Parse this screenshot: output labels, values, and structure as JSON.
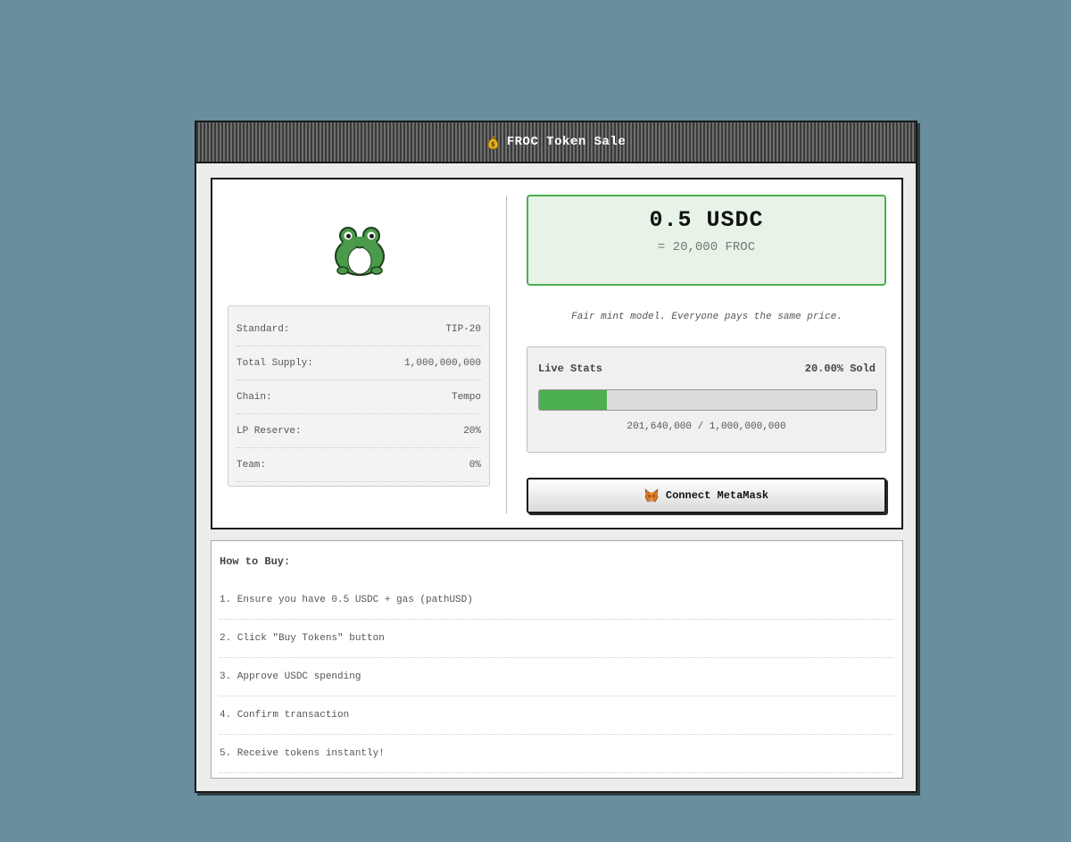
{
  "window": {
    "title": "FROC Token Sale"
  },
  "token_info": [
    {
      "label": "Standard:",
      "value": "TIP-20"
    },
    {
      "label": "Total Supply:",
      "value": "1,000,000,000"
    },
    {
      "label": "Chain:",
      "value": "Tempo"
    },
    {
      "label": "LP Reserve:",
      "value": "20%"
    },
    {
      "label": "Team:",
      "value": "0%"
    }
  ],
  "price": {
    "amount": "0.5 USDC",
    "equivalent": "= 20,000 FROC"
  },
  "fair_mint_note": "Fair mint model. Everyone pays the same price.",
  "live_stats": {
    "label": "Live Stats",
    "sold_text": "20.00% Sold",
    "progress_fraction": 0.2,
    "caption": "201,640,000 / 1,000,000,000"
  },
  "connect_button": {
    "label": "Connect MetaMask",
    "icon": "metamask-fox-icon"
  },
  "how_to_buy": {
    "title": "How to Buy:",
    "steps": [
      "1. Ensure you have 0.5 USDC + gas (pathUSD)",
      "2. Click \"Buy Tokens\" button",
      "3. Approve USDC spending",
      "4. Confirm transaction",
      "5. Receive tokens instantly!"
    ]
  },
  "colors": {
    "background": "#698e9e",
    "accent_green": "#4caf50",
    "price_box_bg": "#e6f3e6"
  }
}
